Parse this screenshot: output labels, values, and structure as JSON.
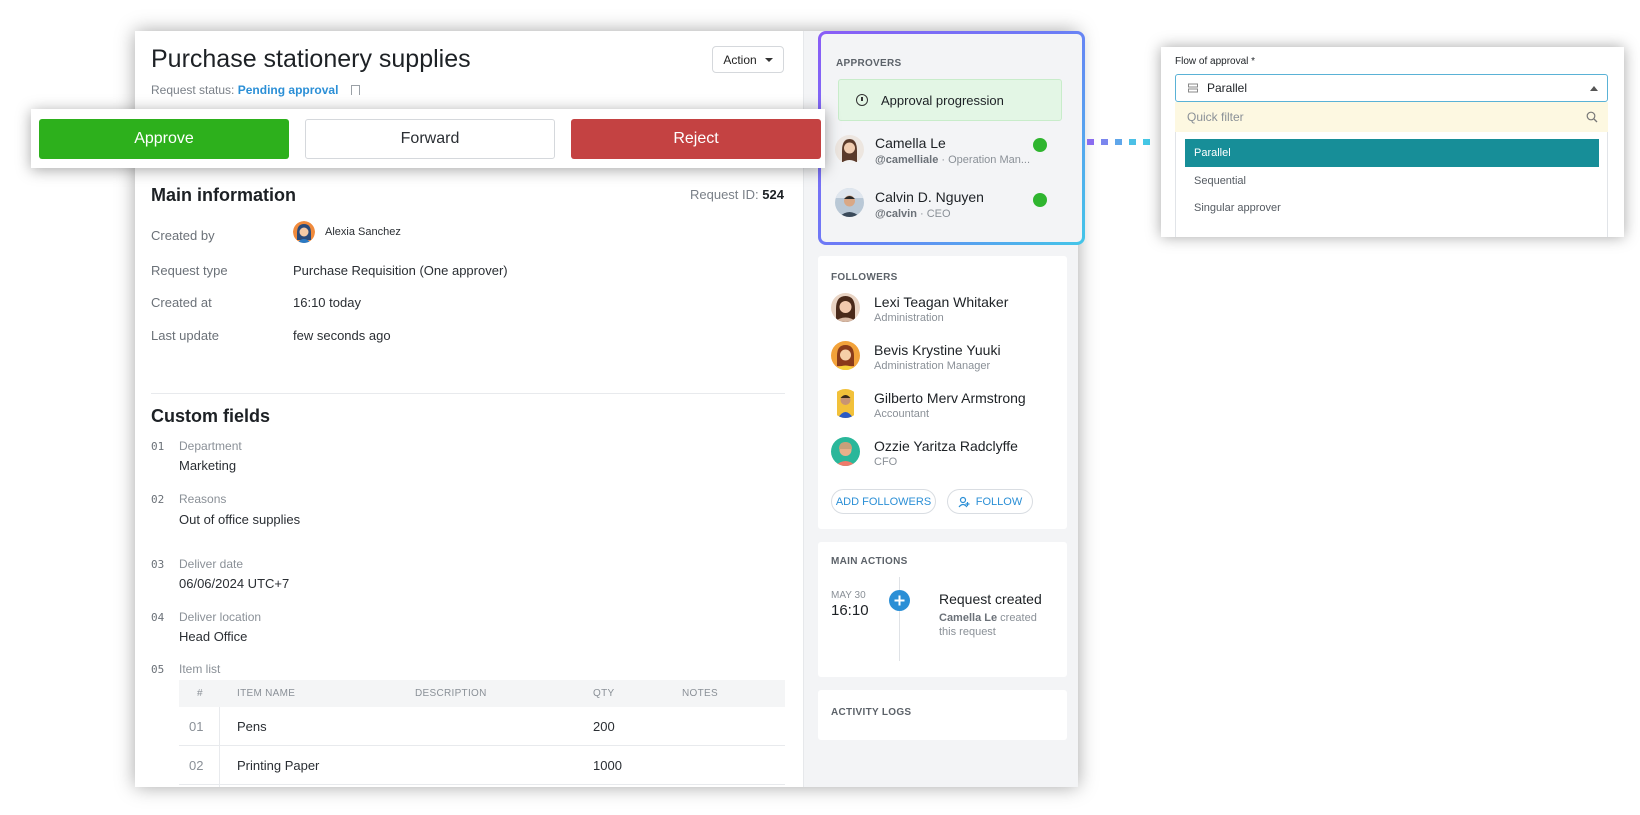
{
  "request": {
    "title": "Purchase stationery supplies",
    "status_label": "Request status:",
    "status_value": "Pending approval",
    "action_label": "Action"
  },
  "action_bar": {
    "approve": "Approve",
    "forward": "Forward",
    "reject": "Reject",
    "colors": {
      "approve": "#2db01c",
      "reject": "#c44242"
    }
  },
  "main_info": {
    "title": "Main information",
    "request_id_label": "Request ID:",
    "request_id": "524",
    "rows": [
      {
        "label": "Created by",
        "value": "Alexia Sanchez"
      },
      {
        "label": "Request type",
        "value": "Purchase Requisition  (One approver)"
      },
      {
        "label": "Created at",
        "value": "16:10 today"
      },
      {
        "label": "Last update",
        "value": "few seconds ago"
      }
    ]
  },
  "custom_fields": {
    "title": "Custom fields",
    "fields": [
      {
        "num": "01",
        "label": "Department",
        "value": "Marketing"
      },
      {
        "num": "02",
        "label": "Reasons",
        "value": "Out of office supplies"
      },
      {
        "num": "03",
        "label": "Deliver date",
        "value": "06/06/2024 UTC+7"
      },
      {
        "num": "04",
        "label": "Deliver location",
        "value": "Head Office"
      },
      {
        "num": "05",
        "label": "Item list",
        "value": ""
      }
    ],
    "table": {
      "headers": [
        "#",
        "ITEM NAME",
        "DESCRIPTION",
        "QTY",
        "NOTES"
      ],
      "rows": [
        {
          "idx": "01",
          "name": "Pens",
          "description": "",
          "qty": "200",
          "notes": ""
        },
        {
          "idx": "02",
          "name": "Printing Paper",
          "description": "",
          "qty": "1000",
          "notes": ""
        }
      ]
    }
  },
  "approvers": {
    "title": "APPROVERS",
    "progress_label": "Approval progression",
    "people": [
      {
        "name": "Camella Le",
        "handle": "@camelliale",
        "role": "Operation Man...",
        "status_color": "#2fb52f"
      },
      {
        "name": "Calvin D. Nguyen",
        "handle": "@calvin",
        "role": "CEO",
        "status_color": "#2fb52f"
      }
    ]
  },
  "followers": {
    "title": "FOLLOWERS",
    "people": [
      {
        "name": "Lexi Teagan Whitaker",
        "role": "Administration"
      },
      {
        "name": "Bevis Krystine Yuuki",
        "role": "Administration Manager"
      },
      {
        "name": "Gilberto Merv Armstrong",
        "role": "Accountant"
      },
      {
        "name": "Ozzie Yaritza Radclyffe",
        "role": "CFO"
      }
    ],
    "add_label": "ADD FOLLOWERS",
    "follow_label": "FOLLOW"
  },
  "main_actions": {
    "title": "MAIN ACTIONS",
    "date": "MAY 30",
    "time": "16:10",
    "event": "Request created",
    "actor": "Camella Le",
    "detail_1": "created",
    "detail_2": "this request"
  },
  "activity_logs": {
    "title": "ACTIVITY LOGS"
  },
  "approval_flow": {
    "label": "Flow of approval *",
    "selected": "Parallel",
    "filter_placeholder": "Quick filter",
    "options": [
      "Parallel",
      "Sequential",
      "Singular approver"
    ]
  }
}
